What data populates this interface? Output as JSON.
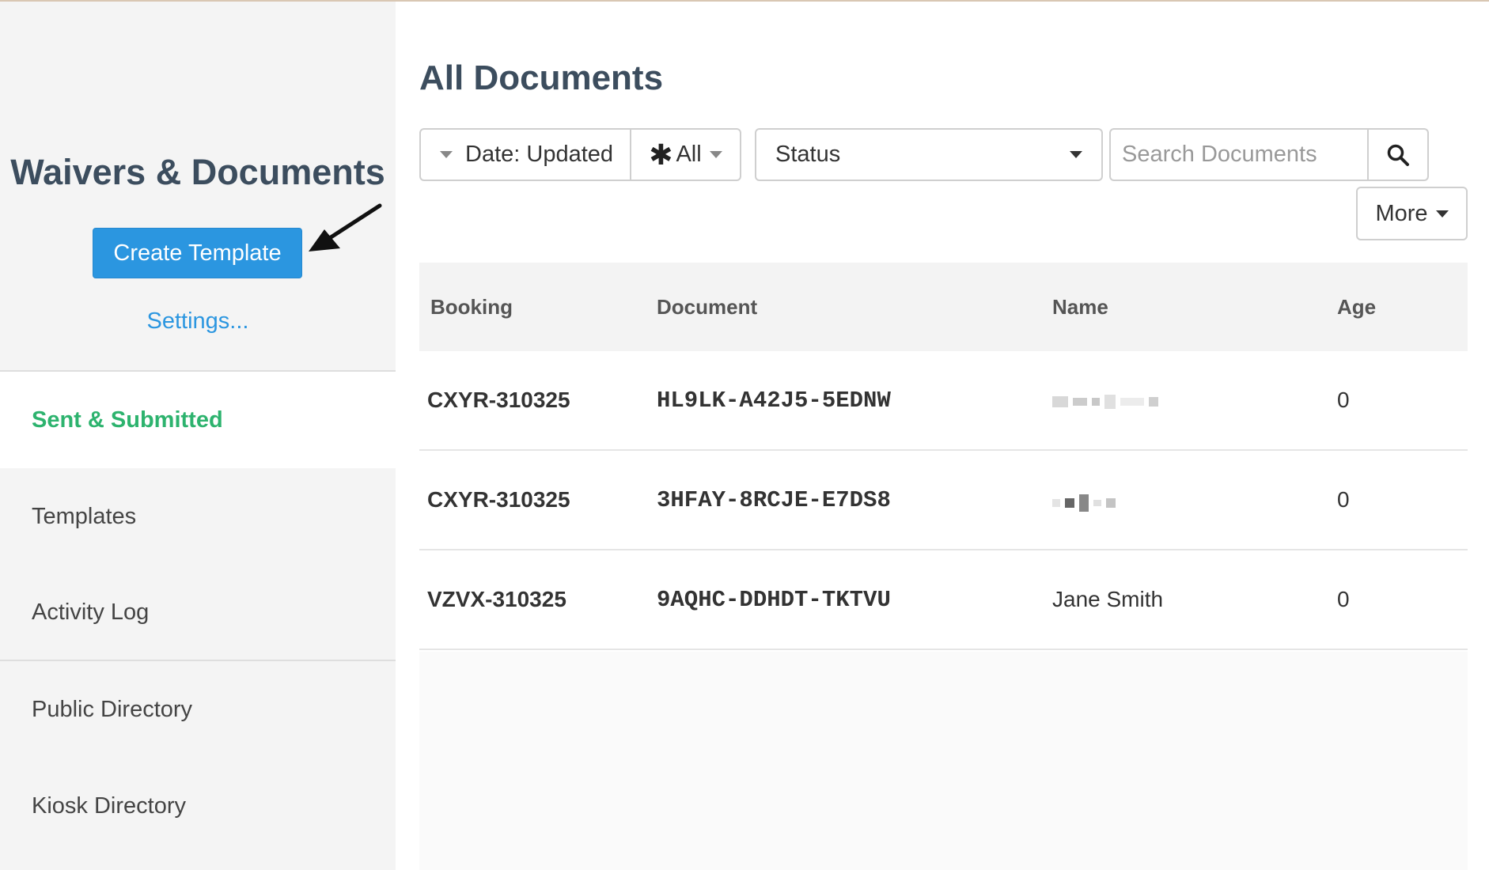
{
  "sidebar": {
    "title": "Waivers & Documents",
    "create_button": "Create Template",
    "settings_link": "Settings...",
    "items": [
      {
        "label": "Sent & Submitted",
        "active": true
      },
      {
        "label": "Templates",
        "active": false
      },
      {
        "label": "Activity Log",
        "active": false
      },
      {
        "label": "Public Directory",
        "active": false
      },
      {
        "label": "Kiosk Directory",
        "active": false
      }
    ]
  },
  "main": {
    "title": "All Documents",
    "filters": {
      "date_label": "Date: Updated",
      "all_label": "All",
      "status_label": "Status",
      "search_placeholder": "Search Documents",
      "more_label": "More"
    },
    "table": {
      "headers": [
        "Booking",
        "Document",
        "Name",
        "Age"
      ],
      "rows": [
        {
          "booking": "CXYR-310325",
          "document": "HL9LK-A42J5-5EDNW",
          "name": "",
          "age": "0"
        },
        {
          "booking": "CXYR-310325",
          "document": "3HFAY-8RCJE-E7DS8",
          "name": "",
          "age": "0"
        },
        {
          "booking": "VZVX-310325",
          "document": "9AQHC-DDHDT-TKTVU",
          "name": "Jane Smith",
          "age": "0"
        }
      ]
    }
  },
  "colors": {
    "accent_blue": "#2b96e0",
    "active_green": "#2db36e",
    "title_slate": "#3c4d5e"
  },
  "icons": {
    "search": "search-icon",
    "arrow": "arrow-pointer-icon",
    "caret": "caret-down-icon",
    "asterisk": "asterisk-icon"
  }
}
